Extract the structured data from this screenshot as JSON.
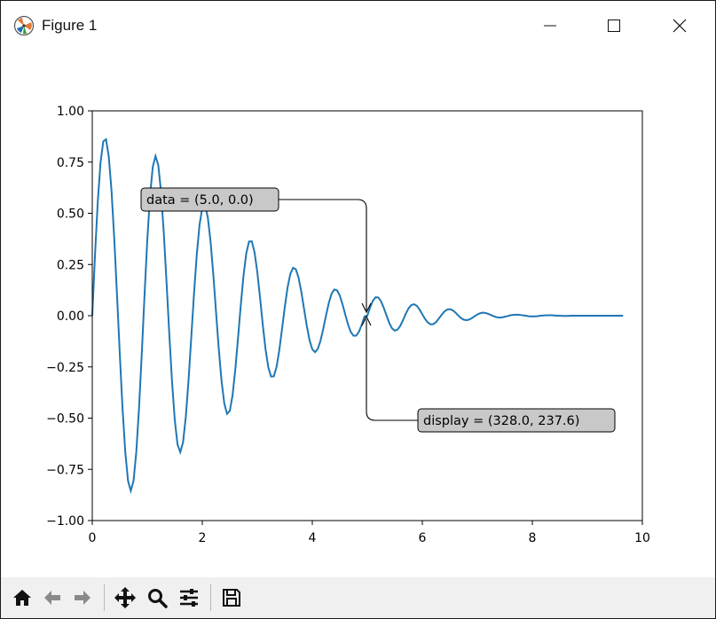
{
  "window": {
    "title": "Figure 1",
    "icon": "matplotlib-logo-icon"
  },
  "toolbar": {
    "buttons": [
      "home-icon",
      "back-arrow-icon",
      "forward-arrow-icon",
      "pan-move-icon",
      "zoom-magnifier-icon",
      "configure-subplots-icon",
      "save-floppy-icon"
    ]
  },
  "chart_data": {
    "type": "line",
    "function_note": "damped cosine-type curve; points sampled",
    "xlim": [
      0,
      10
    ],
    "ylim": [
      -1.0,
      1.0
    ],
    "xticks": [
      "0",
      "2",
      "4",
      "6",
      "8",
      "10"
    ],
    "yticks": [
      "1.00",
      "0.75",
      "0.50",
      "0.25",
      "0.00",
      "−0.25",
      "−0.50",
      "−0.75",
      "−1.00"
    ],
    "x": [
      0,
      0.05,
      0.1,
      0.15,
      0.2,
      0.25,
      0.3,
      0.35,
      0.4,
      0.45,
      0.5,
      0.55,
      0.6,
      0.65,
      0.7,
      0.75,
      0.8,
      0.85,
      0.9,
      0.95,
      1.0,
      1.05,
      1.1,
      1.15,
      1.2,
      1.25,
      1.3,
      1.35,
      1.4,
      1.45,
      1.5,
      1.55,
      1.6,
      1.65,
      1.7,
      1.75,
      1.8,
      1.85,
      1.9,
      1.95,
      2.0,
      2.05,
      2.1,
      2.15,
      2.2,
      2.25,
      2.3,
      2.35,
      2.4,
      2.45,
      2.5,
      2.55,
      2.6,
      2.65,
      2.7,
      2.75,
      2.8,
      2.85,
      2.9,
      2.95,
      3.0,
      3.05,
      3.1,
      3.15,
      3.2,
      3.25,
      3.3,
      3.35,
      3.4,
      3.45,
      3.5,
      3.55,
      3.6,
      3.65,
      3.7,
      3.75,
      3.8,
      3.85,
      3.9,
      3.95,
      4.0,
      4.05,
      4.1,
      4.15,
      4.2,
      4.25,
      4.3,
      4.35,
      4.4,
      4.45,
      4.5,
      4.55,
      4.6,
      4.65,
      4.7,
      4.75,
      4.8,
      4.85,
      4.9,
      4.95,
      5.0,
      5.05,
      5.1,
      5.15,
      5.2,
      5.25,
      5.3,
      5.35,
      5.4,
      5.45,
      5.5,
      5.55,
      5.6,
      5.65,
      5.7,
      5.75,
      5.8,
      5.85,
      5.9,
      5.95,
      6.0,
      6.05,
      6.1,
      6.15,
      6.2,
      6.25,
      6.3,
      6.35,
      6.4,
      6.45,
      6.5,
      6.55,
      6.6,
      6.65,
      6.7,
      6.75,
      6.8,
      6.85,
      6.9,
      6.95,
      7.0,
      7.05,
      7.1,
      7.15,
      7.2,
      7.25,
      7.3,
      7.35,
      7.4,
      7.45,
      7.5,
      7.55,
      7.6,
      7.65,
      7.7,
      7.75,
      7.8,
      7.85,
      7.9,
      7.95,
      8.0,
      8.05,
      8.1,
      8.15,
      8.2,
      8.25,
      8.3,
      8.35,
      8.4,
      8.45,
      8.5,
      8.55,
      8.6,
      8.65,
      8.7,
      8.75,
      8.8,
      8.85,
      8.9,
      8.95,
      9.0,
      9.05,
      9.1,
      9.15,
      9.2,
      9.25,
      9.3,
      9.35,
      9.4,
      9.45,
      9.5,
      9.55,
      9.6,
      9.65,
      9.7,
      9.75,
      9.8,
      9.85,
      9.9,
      9.95,
      10.0
    ],
    "y": [
      0.0,
      0.298,
      0.556,
      0.747,
      0.851,
      0.861,
      0.777,
      0.609,
      0.375,
      0.1,
      -0.186,
      -0.451,
      -0.666,
      -0.806,
      -0.855,
      -0.806,
      -0.666,
      -0.451,
      -0.186,
      0.1,
      0.368,
      0.585,
      0.727,
      0.779,
      0.735,
      0.605,
      0.405,
      0.164,
      -0.088,
      -0.322,
      -0.51,
      -0.629,
      -0.666,
      -0.618,
      -0.495,
      -0.315,
      -0.104,
      0.109,
      0.299,
      0.444,
      0.527,
      0.539,
      0.481,
      0.363,
      0.202,
      0.018,
      -0.163,
      -0.318,
      -0.428,
      -0.479,
      -0.465,
      -0.389,
      -0.263,
      -0.108,
      0.053,
      0.197,
      0.305,
      0.362,
      0.363,
      0.31,
      0.213,
      0.088,
      -0.045,
      -0.164,
      -0.252,
      -0.297,
      -0.296,
      -0.25,
      -0.168,
      -0.064,
      0.043,
      0.137,
      0.203,
      0.234,
      0.227,
      0.186,
      0.117,
      0.033,
      -0.05,
      -0.12,
      -0.164,
      -0.178,
      -0.162,
      -0.121,
      -0.063,
      0.002,
      0.062,
      0.107,
      0.128,
      0.124,
      0.098,
      0.055,
      0.005,
      -0.043,
      -0.08,
      -0.098,
      -0.097,
      -0.077,
      -0.043,
      -0.003,
      0.0,
      0.04,
      0.072,
      0.09,
      0.089,
      0.07,
      0.038,
      0.0,
      -0.036,
      -0.062,
      -0.073,
      -0.068,
      -0.049,
      -0.021,
      0.01,
      0.036,
      0.052,
      0.056,
      0.048,
      0.03,
      0.007,
      -0.016,
      -0.033,
      -0.042,
      -0.041,
      -0.031,
      -0.014,
      0.004,
      0.02,
      0.03,
      0.032,
      0.027,
      0.016,
      0.002,
      -0.011,
      -0.019,
      -0.022,
      -0.019,
      -0.012,
      -0.003,
      0.006,
      0.012,
      0.015,
      0.013,
      0.009,
      0.003,
      -0.003,
      -0.007,
      -0.009,
      -0.008,
      -0.005,
      -0.002,
      0.002,
      0.004,
      0.005,
      0.005,
      0.003,
      0.001,
      -0.001,
      -0.003,
      -0.003,
      -0.003,
      -0.002,
      0.0,
      0.001,
      0.002,
      0.002,
      0.002,
      0.001,
      0.0,
      0.0,
      -0.001,
      -0.001,
      -0.001,
      0.0,
      0.0,
      0.0,
      0.0,
      0.0,
      0.0,
      0.0,
      0.0,
      0.0,
      0.0,
      0.0,
      0.0,
      0.0,
      0.0,
      0.0,
      0.0,
      0.0,
      0.0,
      0.0,
      0.0
    ],
    "annotations": [
      {
        "text": "data = (5.0, 0.0)",
        "point": [
          5.0,
          0.0
        ]
      },
      {
        "text": "display = (328.0, 237.6)",
        "point": [
          5.0,
          0.0
        ]
      }
    ],
    "color": "#1f77b4"
  }
}
